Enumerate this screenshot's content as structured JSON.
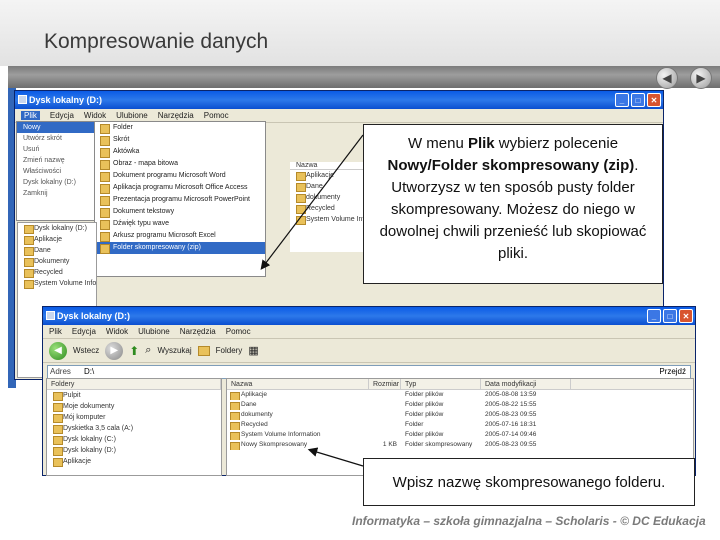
{
  "slide": {
    "title": "Kompresowanie danych",
    "footer": "Informatyka – szkoła gimnazjalna – Scholaris - © DC Edukacja"
  },
  "window1": {
    "title": "Dysk lokalny (D:)",
    "menu": [
      "Plik",
      "Edycja",
      "Widok",
      "Ulubione",
      "Narzędzia",
      "Pomoc"
    ],
    "file_menu": [
      {
        "label": "Nowy",
        "selected": true
      },
      {
        "label": "Utwórz skrót",
        "selected": false
      },
      {
        "label": "Usuń",
        "selected": false
      },
      {
        "label": "Zmień nazwę",
        "selected": false
      },
      {
        "label": "Właściwości",
        "selected": false
      },
      {
        "label": "Dysk lokalny (D:)",
        "selected": false
      },
      {
        "label": "Zamknij",
        "selected": false
      }
    ],
    "new_submenu": [
      {
        "label": "Folder",
        "selected": false
      },
      {
        "label": "Skrót",
        "selected": false
      },
      {
        "label": "Aktówka",
        "selected": false
      },
      {
        "label": "Obraz - mapa bitowa",
        "selected": false
      },
      {
        "label": "Dokument programu Microsoft Word",
        "selected": false
      },
      {
        "label": "Aplikacja programu Microsoft Office Access",
        "selected": false
      },
      {
        "label": "Prezentacja programu Microsoft PowerPoint",
        "selected": false
      },
      {
        "label": "Dokument tekstowy",
        "selected": false
      },
      {
        "label": "Dźwięk typu wave",
        "selected": false
      },
      {
        "label": "Arkusz programu Microsoft Excel",
        "selected": false
      },
      {
        "label": "Folder skompresowany (zip)",
        "selected": true
      }
    ],
    "tree": [
      "Dysk lokalny (D:)",
      "Aplikacje",
      "Dane",
      "Dokumenty",
      "Recycled",
      "System Volume Information"
    ],
    "list_header": "Nazwa",
    "list": [
      "Aplikacje",
      "Dane",
      "dokumenty",
      "Recycled",
      "System Volume Inf"
    ]
  },
  "callout1": {
    "line1_pre": "W menu ",
    "line1_bold": "Plik",
    "line1_post": " wybierz polecenie",
    "line2_bold": "Nowy/Folder skompresowany (zip)",
    "line2_post": ".",
    "rest": "Utworzysz w ten sposób pusty folder skompresowany. Możesz do niego w dowolnej chwili przenieść lub skopiować pliki."
  },
  "window2": {
    "title": "Dysk lokalny (D:)",
    "menu": [
      "Plik",
      "Edycja",
      "Widok",
      "Ulubione",
      "Narzędzia",
      "Pomoc"
    ],
    "toolbar": {
      "back": "Wstecz",
      "search": "Wyszukaj",
      "folders": "Foldery"
    },
    "address_label": "Adres",
    "address": "D:\\",
    "go": "Przejdź",
    "tree_header": "Foldery",
    "tree": [
      "Pulpit",
      "Moje dokumenty",
      "Mój komputer",
      "Dyskietka 3,5 cala (A:)",
      "Dysk lokalny (C:)",
      "Dysk lokalny (D:)",
      "Aplikacje"
    ],
    "columns": [
      "Nazwa",
      "Rozmiar",
      "Typ",
      "Data modyfikacji"
    ],
    "rows": [
      {
        "name": "Aplikacje",
        "size": "",
        "type": "Folder plików",
        "date": "2005-08-08 13:59"
      },
      {
        "name": "Dane",
        "size": "",
        "type": "Folder plików",
        "date": "2005-08-22 15:55"
      },
      {
        "name": "dokumenty",
        "size": "",
        "type": "Folder plików",
        "date": "2005-08-23 09:55"
      },
      {
        "name": "Recycled",
        "size": "",
        "type": "Folder",
        "date": "2005-07-16 18:31"
      },
      {
        "name": "System Volume Information",
        "size": "",
        "type": "Folder plików",
        "date": "2005-07-14 09:46"
      },
      {
        "name": "Nowy Skompresowany",
        "size": "1 KB",
        "type": "Folder skompresowany",
        "date": "2005-08-23 09:55"
      }
    ]
  },
  "callout2": {
    "text": "Wpisz nazwę skompresowanego folderu."
  }
}
